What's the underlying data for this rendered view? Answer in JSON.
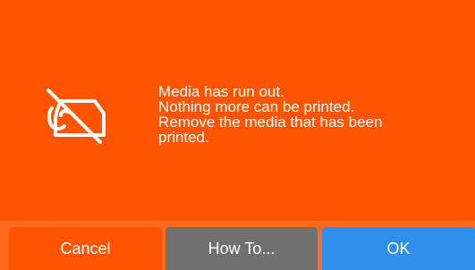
{
  "dialog": {
    "icon": "media-out-icon",
    "message_lines": [
      "Media has run out.",
      "Nothing more can be printed.",
      "Remove the media that has been",
      "printed."
    ]
  },
  "buttons": {
    "cancel_label": "Cancel",
    "howto_label": "How To...",
    "ok_label": "OK"
  },
  "colors": {
    "alert_background": "#ff5500",
    "footer_background": "#ff6a1c",
    "cancel_button": "#ff5500",
    "howto_button": "#707070",
    "ok_button": "#2f8fe8",
    "text": "#ffffff"
  }
}
